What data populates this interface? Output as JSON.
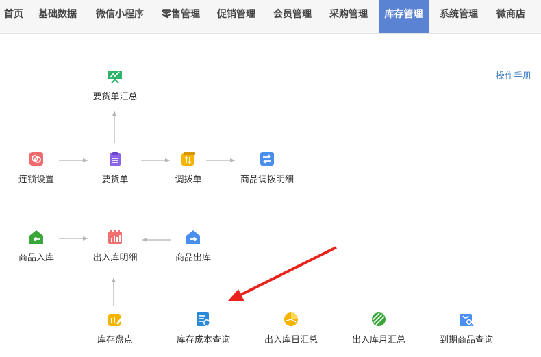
{
  "nav": {
    "items": [
      {
        "label": "首页"
      },
      {
        "label": "基础数据"
      },
      {
        "label": "微信小程序"
      },
      {
        "label": "零售管理"
      },
      {
        "label": "促销管理"
      },
      {
        "label": "会员管理"
      },
      {
        "label": "采购管理"
      },
      {
        "label": "库存管理",
        "active": true
      },
      {
        "label": "系统管理"
      },
      {
        "label": "微商店"
      }
    ],
    "active_color": "#5b83d4"
  },
  "manual_link": "操作手册",
  "nodes": {
    "request_summary": {
      "label": "要货单汇总",
      "icon": "presentation-chart-icon",
      "color": "#2eb36b"
    },
    "chain_settings": {
      "label": "连锁设置",
      "icon": "link-icon",
      "color": "#f06b6b"
    },
    "request_order": {
      "label": "要货单",
      "icon": "clipboard-icon",
      "color": "#8a63e8"
    },
    "transfer_order": {
      "label": "调拨单",
      "icon": "transfer-doc-icon",
      "color": "#f5b400"
    },
    "transfer_detail": {
      "label": "商品调拨明细",
      "icon": "exchange-icon",
      "color": "#4a8ef0"
    },
    "stock_in": {
      "label": "商品入库",
      "icon": "house-in-icon",
      "color": "#3aa63a"
    },
    "in_out_detail": {
      "label": "出入库明细",
      "icon": "bar-chart-icon",
      "color": "#f07070"
    },
    "stock_out": {
      "label": "商品出库",
      "icon": "house-out-icon",
      "color": "#4a8ef0"
    },
    "stocktake": {
      "label": "库存盘点",
      "icon": "stocktake-icon",
      "color": "#f5b400"
    },
    "cost_query": {
      "label": "库存成本查询",
      "icon": "cost-doc-icon",
      "color": "#2a8ad8"
    },
    "daily_summary": {
      "label": "出入库日汇总",
      "icon": "pie-chart-icon",
      "color": "#f5b400"
    },
    "monthly_summary": {
      "label": "出入库月汇总",
      "icon": "stripe-ball-icon",
      "color": "#3aa63a"
    },
    "expiry_query": {
      "label": "到期商品查询",
      "icon": "bag-search-icon",
      "color": "#4a8ef0"
    }
  },
  "colors": {
    "flow_arrow": "#b5b5b5",
    "annotation_arrow": "#e8231c",
    "link": "#4a86c8"
  }
}
